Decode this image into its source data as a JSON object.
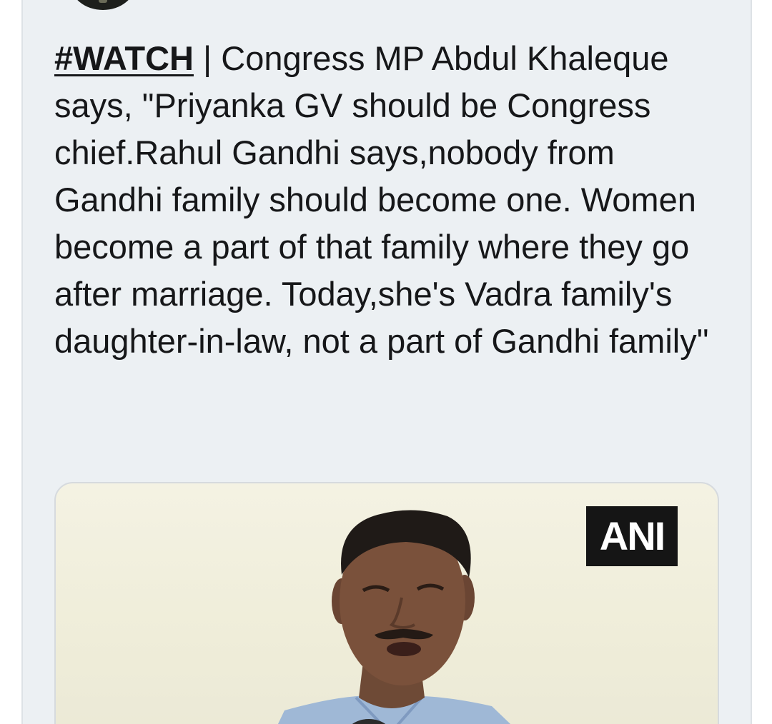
{
  "tweet": {
    "hashtag": "#WATCH",
    "separator": " | ",
    "text_line_1": "Congress MP Abdul",
    "text_rest": "Khaleque says, \"Priyanka GV should be Congress chief.Rahul Gandhi says,nobody from Gandhi family should become one. Women become a part of that family where they go after marriage. Today,she's Vadra family's daughter-in-law, not a part of Gandhi family\""
  },
  "media": {
    "watermark": "ANI",
    "type": "video-thumbnail"
  },
  "icons": {
    "avatar": "avatar-icon"
  },
  "colors": {
    "card_background": "#ecf0f3",
    "text": "#161719",
    "watermark_background": "#151515",
    "watermark_text": "#ffffff"
  }
}
